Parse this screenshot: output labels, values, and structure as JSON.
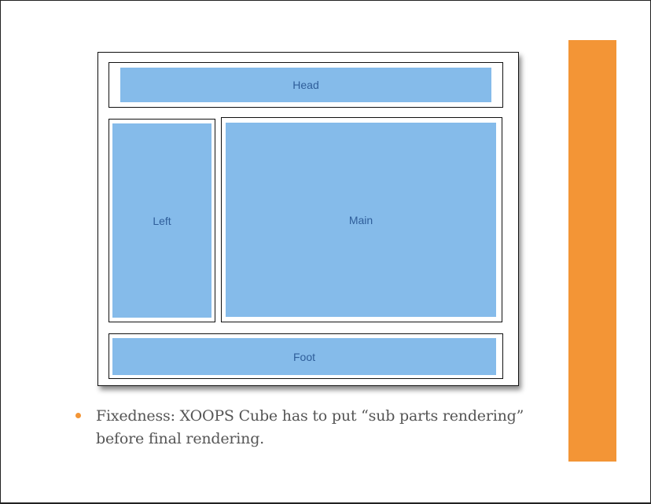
{
  "colors": {
    "accent": "#F39536",
    "block_fill": "#85BBEA",
    "block_text": "#2F5E9A",
    "bullet": "#F39536"
  },
  "diagram": {
    "head_label": "Head",
    "left_label": "Left",
    "main_label": "Main",
    "foot_label": "Foot"
  },
  "bullets": [
    {
      "text": "Fixedness: XOOPS Cube has to put “sub parts rendering” before final rendering."
    }
  ]
}
